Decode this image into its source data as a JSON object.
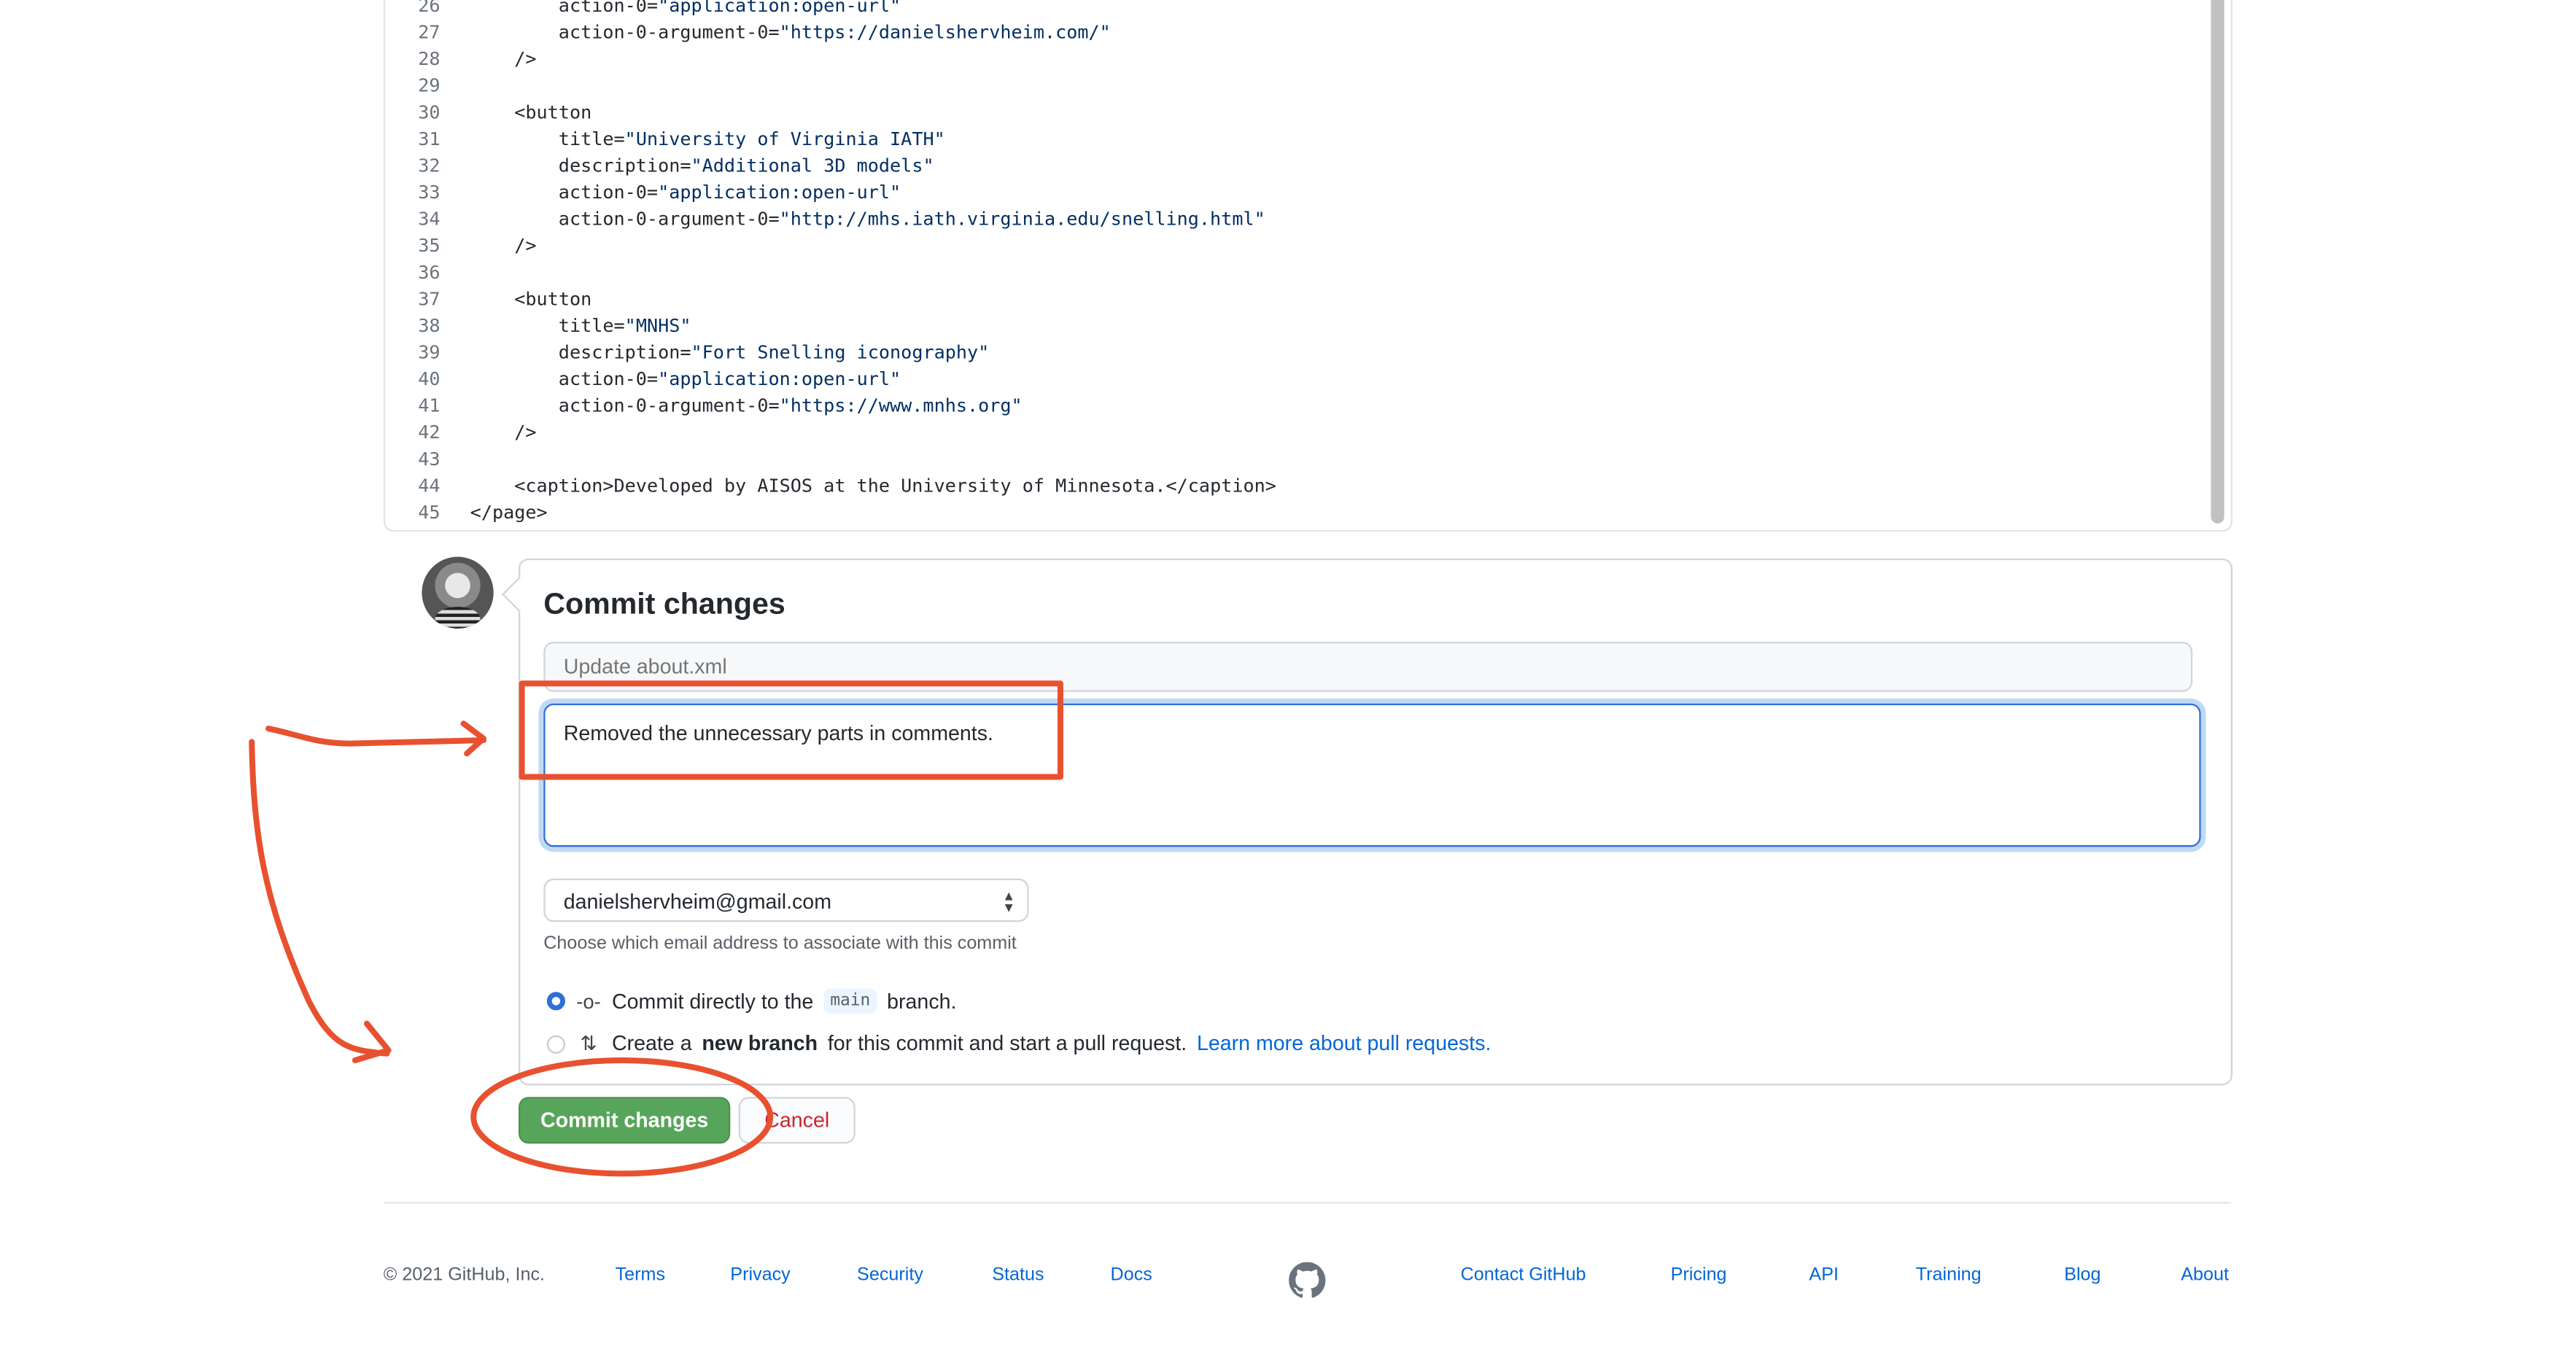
{
  "code": {
    "lines": [
      {
        "n": "26",
        "indent": "        ",
        "key": "action-0=",
        "str": "\"application:open-url\"",
        "tail": ""
      },
      {
        "n": "27",
        "indent": "        ",
        "key": "action-0-argument-0=",
        "str": "\"https://danielshervheim.com/\"",
        "tail": ""
      },
      {
        "n": "28",
        "indent": "    ",
        "key": "/>",
        "str": "",
        "tail": ""
      },
      {
        "n": "29",
        "indent": "",
        "key": "",
        "str": "",
        "tail": ""
      },
      {
        "n": "30",
        "indent": "    ",
        "key": "<button",
        "str": "",
        "tail": ""
      },
      {
        "n": "31",
        "indent": "        ",
        "key": "title=",
        "str": "\"University of Virginia IATH\"",
        "tail": ""
      },
      {
        "n": "32",
        "indent": "        ",
        "key": "description=",
        "str": "\"Additional 3D models\"",
        "tail": ""
      },
      {
        "n": "33",
        "indent": "        ",
        "key": "action-0=",
        "str": "\"application:open-url\"",
        "tail": ""
      },
      {
        "n": "34",
        "indent": "        ",
        "key": "action-0-argument-0=",
        "str": "\"http://mhs.iath.virginia.edu/snelling.html\"",
        "tail": ""
      },
      {
        "n": "35",
        "indent": "    ",
        "key": "/>",
        "str": "",
        "tail": ""
      },
      {
        "n": "36",
        "indent": "",
        "key": "",
        "str": "",
        "tail": ""
      },
      {
        "n": "37",
        "indent": "    ",
        "key": "<button",
        "str": "",
        "tail": ""
      },
      {
        "n": "38",
        "indent": "        ",
        "key": "title=",
        "str": "\"MNHS\"",
        "tail": ""
      },
      {
        "n": "39",
        "indent": "        ",
        "key": "description=",
        "str": "\"Fort Snelling iconography\"",
        "tail": ""
      },
      {
        "n": "40",
        "indent": "        ",
        "key": "action-0=",
        "str": "\"application:open-url\"",
        "tail": ""
      },
      {
        "n": "41",
        "indent": "        ",
        "key": "action-0-argument-0=",
        "str": "\"https://www.mnhs.org\"",
        "tail": ""
      },
      {
        "n": "42",
        "indent": "    ",
        "key": "/>",
        "str": "",
        "tail": ""
      },
      {
        "n": "43",
        "indent": "",
        "key": "",
        "str": "",
        "tail": ""
      },
      {
        "n": "44",
        "indent": "    ",
        "key": "<caption>Developed by AISOS at the University of Minnesota.</caption>",
        "str": "",
        "tail": ""
      },
      {
        "n": "45",
        "indent": "",
        "key": "</page>",
        "str": "",
        "tail": ""
      }
    ]
  },
  "commit": {
    "title": "Commit changes",
    "summary_placeholder": "Update about.xml",
    "description": "Removed the unnecessary parts in comments.",
    "email": "danielshervheim@gmail.com",
    "email_help": "Choose which email address to associate with this commit",
    "option_direct": {
      "before": "Commit directly to the",
      "branch": "main",
      "after": "branch.",
      "selected": true
    },
    "option_new_branch": {
      "before": "Create a",
      "bold": "new branch",
      "after": "for this commit and start a pull request.",
      "link": "Learn more about pull requests.",
      "selected": false
    },
    "commit_button": "Commit changes",
    "cancel_button": "Cancel"
  },
  "footer": {
    "copyright": "© 2021 GitHub, Inc.",
    "left_links": [
      "Terms",
      "Privacy",
      "Security",
      "Status",
      "Docs"
    ],
    "right_links": [
      "Contact GitHub",
      "Pricing",
      "API",
      "Training",
      "Blog",
      "About"
    ]
  },
  "colors": {
    "annotation": "#e8512f",
    "commit_green": "#57a55a",
    "link": "#0366d6",
    "cancel_red": "#cb2431"
  }
}
